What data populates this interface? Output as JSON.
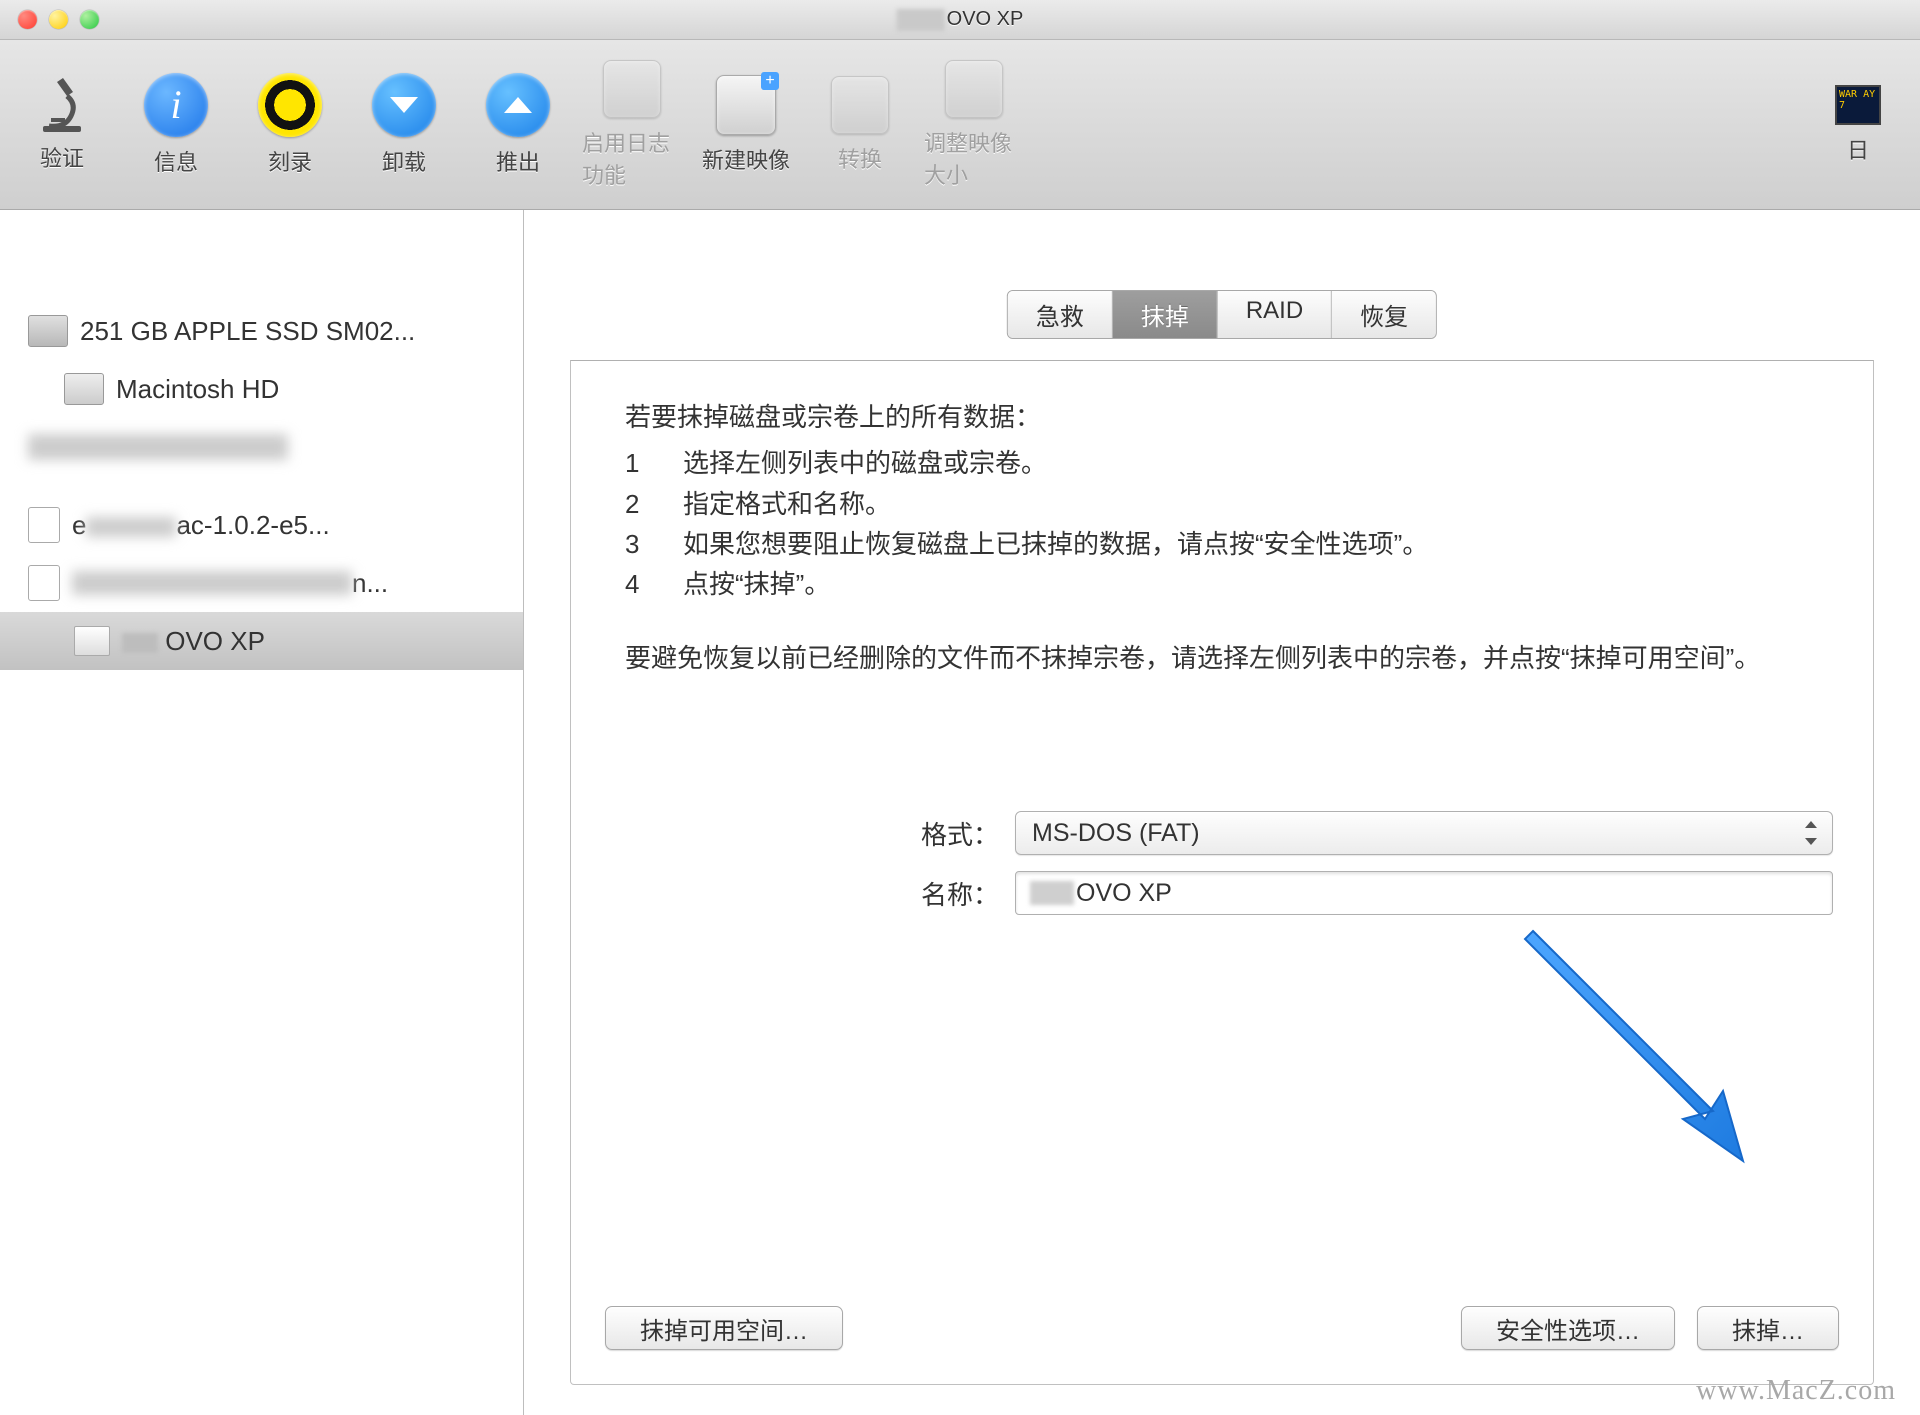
{
  "window": {
    "title_obscured_suffix": "OVO XP"
  },
  "toolbar": {
    "verify": "验证",
    "info": "信息",
    "burn": "刻录",
    "unmount": "卸载",
    "eject": "推出",
    "enable_journaling": "启用日志功能",
    "new_image": "新建映像",
    "convert": "转换",
    "resize_image": "调整映像大小",
    "log": "日"
  },
  "sidebar": {
    "items": [
      {
        "label": "251 GB APPLE SSD SM02...",
        "indent": 0,
        "icon": "hdd"
      },
      {
        "label": "Macintosh HD",
        "indent": 1,
        "icon": "int"
      },
      {
        "label": "",
        "indent": 0,
        "icon": "none",
        "blur": true
      },
      {
        "label": "e          ac-1.0.2-e5...",
        "indent": 0,
        "icon": "img",
        "blur_partial": true
      },
      {
        "label": "                          n...",
        "indent": 0,
        "icon": "img",
        "blur": true
      },
      {
        "label": "    OVO XP",
        "indent": 2,
        "icon": "vol",
        "selected": true
      }
    ]
  },
  "tabs": {
    "first_aid": "急救",
    "erase": "抹掉",
    "raid": "RAID",
    "restore": "恢复"
  },
  "panel": {
    "heading": "若要抹掉磁盘或宗卷上的所有数据：",
    "steps": [
      "选择左侧列表中的磁盘或宗卷。",
      "指定格式和名称。",
      "如果您想要阻止恢复磁盘上已抹掉的数据，请点按“安全性选项”。",
      "点按“抹掉”。"
    ],
    "note": "要避免恢复以前已经删除的文件而不抹掉宗卷，请选择左侧列表中的宗卷，并点按“抹掉可用空间”。",
    "format_label": "格式：",
    "format_value": "MS-DOS (FAT)",
    "name_label": "名称：",
    "name_value_suffix": "OVO XP",
    "erase_free_space_btn": "抹掉可用空间…",
    "security_options_btn": "安全性选项…",
    "erase_btn": "抹掉…"
  },
  "watermark": "www.MacZ.com",
  "terminal_badge": "WAR\nAY 7"
}
